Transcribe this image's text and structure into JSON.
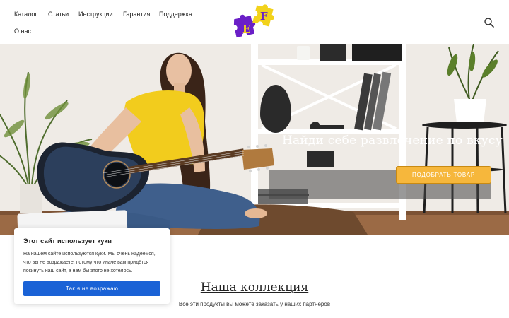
{
  "nav": {
    "items": [
      {
        "label": "Каталог"
      },
      {
        "label": "Статьи"
      },
      {
        "label": "Инструкции"
      },
      {
        "label": "Гарантия"
      },
      {
        "label": "Поддержка"
      },
      {
        "label": "О нас"
      }
    ]
  },
  "logo": {
    "letter_1": "E",
    "letter_2": "F"
  },
  "hero": {
    "title": "Найди себе развлечение по вкусу",
    "cta_label": "Подобрать товар"
  },
  "collection": {
    "title": "Наша коллекция",
    "subtitle": "Все эти продукты вы можете заказать у наших партнёров"
  },
  "cookie": {
    "title": "Этот сайт использует куки",
    "text": "На нашем сайте используются куки. Мы очень надеемся, что вы не возражаете, потому что иначе вам придётся покинуть наш сайт, а нам бы этого не хотелось.",
    "accept_label": "Так я не возражаю"
  },
  "colors": {
    "accent": "#f6b73c",
    "cookie_button": "#1a62d6",
    "logo_purple": "#6a1fc7",
    "logo_yellow": "#f2d21b"
  },
  "icons": {
    "search": "search-icon"
  }
}
